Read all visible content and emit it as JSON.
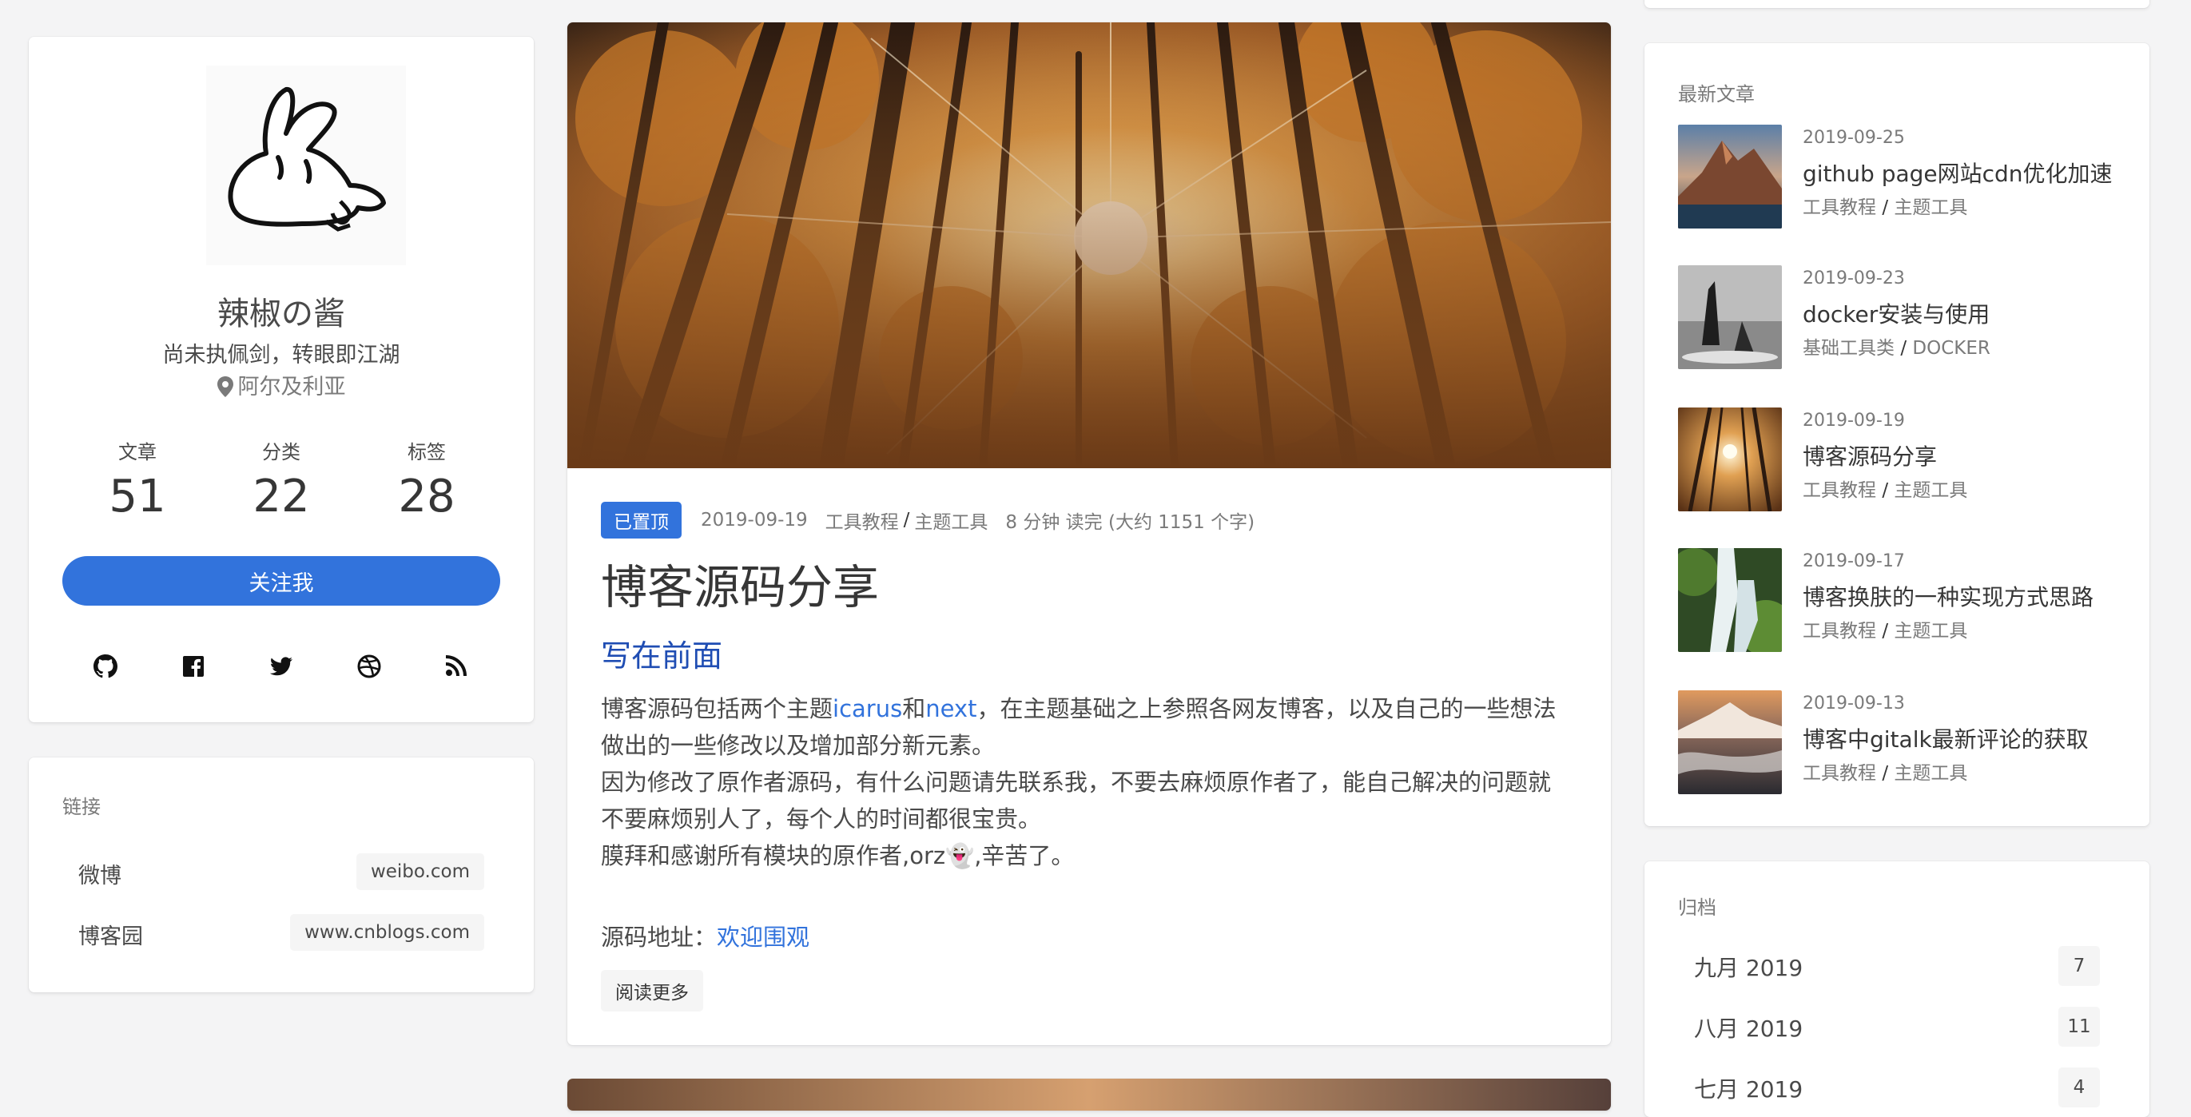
{
  "profile": {
    "name": "辣椒の酱",
    "bio": "尚未执佩剑，转眼即江湖",
    "location": "阿尔及利亚",
    "stats": [
      {
        "label": "文章",
        "value": "51"
      },
      {
        "label": "分类",
        "value": "22"
      },
      {
        "label": "标签",
        "value": "28"
      }
    ],
    "follow_label": "关注我",
    "socials": [
      "github-icon",
      "facebook-icon",
      "twitter-icon",
      "dribbble-icon",
      "rss-icon"
    ]
  },
  "links": {
    "title": "链接",
    "items": [
      {
        "name": "微博",
        "url": "weibo.com"
      },
      {
        "name": "博客园",
        "url": "www.cnblogs.com"
      }
    ]
  },
  "article": {
    "pinned": "已置顶",
    "date": "2019-09-19",
    "category_a": "工具教程",
    "category_sep": "/",
    "category_b": "主题工具",
    "read_time": "8 分钟 读完 (大约 1151 个字)",
    "title": "博客源码分享",
    "heading": "写在前面",
    "p1_a": "博客源码包括两个主题",
    "p1_link1": "icarus",
    "p1_mid": "和",
    "p1_link2": "next",
    "p1_b": "，在主题基础之上参照各网友博客，以及自己的一些想法做出的一些修改以及增加部分新元素。",
    "p2": "因为修改了原作者源码，有什么问题请先联系我，不要去麻烦原作者了，能自己解决的问题就不要麻烦别人了，每个人的时间都很宝贵。",
    "p3": "膜拜和感谢所有模块的原作者,orz👻,辛苦了。",
    "src_label": "源码地址：",
    "src_link": "欢迎围观",
    "read_more": "阅读更多"
  },
  "recent": {
    "title": "最新文章",
    "posts": [
      {
        "date": "2019-09-25",
        "title": "github page网站cdn优化加速",
        "cat_a": "工具教程",
        "cat_b": "主题工具"
      },
      {
        "date": "2019-09-23",
        "title": "docker安装与使用",
        "cat_a": "基础工具类",
        "cat_b": "DOCKER"
      },
      {
        "date": "2019-09-19",
        "title": "博客源码分享",
        "cat_a": "工具教程",
        "cat_b": "主题工具"
      },
      {
        "date": "2019-09-17",
        "title": "博客换肤的一种实现方式思路",
        "cat_a": "工具教程",
        "cat_b": "主题工具"
      },
      {
        "date": "2019-09-13",
        "title": "博客中gitalk最新评论的获取",
        "cat_a": "工具教程",
        "cat_b": "主题工具"
      }
    ],
    "sep": "/"
  },
  "archive": {
    "title": "归档",
    "items": [
      {
        "name": "九月 2019",
        "count": "7"
      },
      {
        "name": "八月 2019",
        "count": "11"
      },
      {
        "name": "七月 2019",
        "count": "4"
      }
    ]
  },
  "colors": {
    "accent": "#3273dc",
    "heading": "#1f4db3"
  }
}
